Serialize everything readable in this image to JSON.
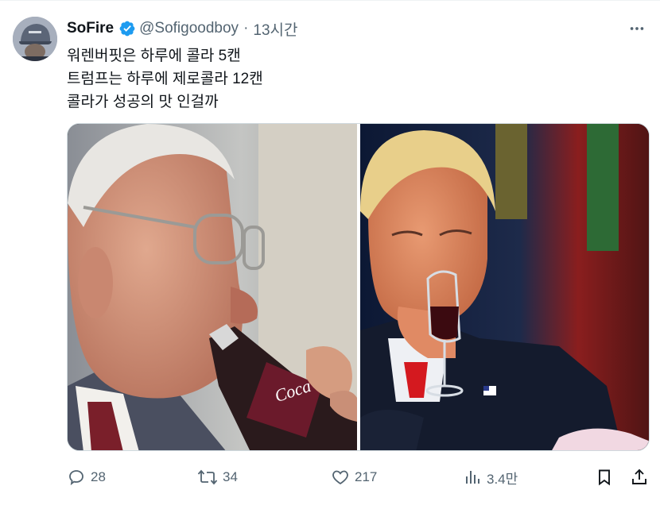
{
  "tweet": {
    "author_name": "SoFire",
    "handle": "@Sofigoodboy",
    "separator": "·",
    "time": "13시간",
    "lines": [
      "워렌버핏은 하루에 콜라 5캔",
      "트럼프는 하루에 제로콜라 12캔",
      "콜라가 성공의 맛 인걸까"
    ]
  },
  "media": {
    "left_photo_label": "Coca",
    "colors": {
      "accent": "#1d9bf0",
      "can": "#6b1a2b"
    }
  },
  "actions": {
    "reply_count": "28",
    "retweet_count": "34",
    "like_count": "217",
    "views_count": "3.4만"
  },
  "icons": [
    "more-icon",
    "verified-badge-icon",
    "reply-icon",
    "retweet-icon",
    "like-icon",
    "views-icon",
    "bookmark-icon",
    "share-icon"
  ]
}
